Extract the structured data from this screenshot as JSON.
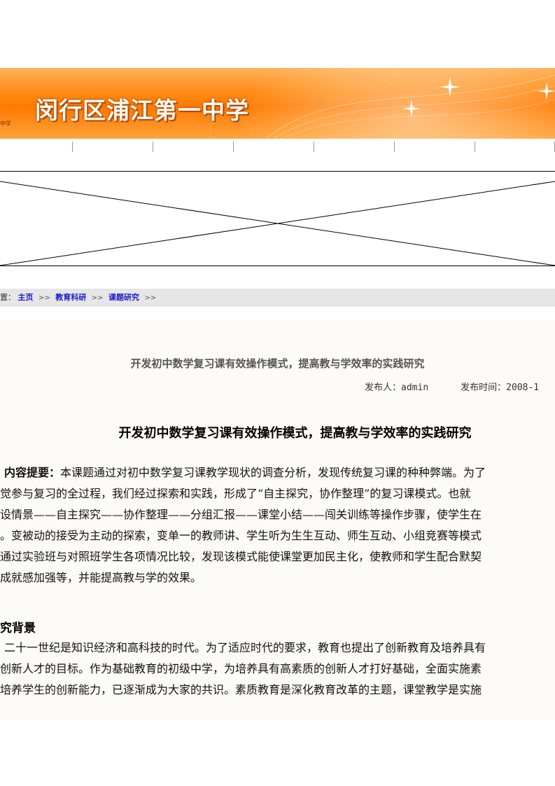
{
  "header": {
    "school_title": "闵行区浦江第一中学",
    "small_text": "中学"
  },
  "nav": {
    "item_count": 8
  },
  "breadcrumb": {
    "prefix": "置：",
    "items": [
      "主页",
      "教育科研",
      "课题研究"
    ],
    "separator": ">>"
  },
  "article": {
    "title": "开发初中数学复习课有效操作模式，提高教与学效率的实践研究",
    "publisher_label": "发布人：",
    "publisher": "admin",
    "time_label": "发布时间：",
    "time": "2008-1",
    "heading": "开发初中数学复习课有效操作模式，提高教与学效率的实践研究",
    "summary_label": "内容提要：",
    "summary_lines": [
      "本课题通过对初中数学复习课教学现状的调查分析，发现传统复习课的种种弊端。为了",
      "觉参与复习的全过程，我们经过探索和实践，形成了“自主探究，协作整理”的复习课模式。也就",
      "设情景——自主探究——协作整理——分组汇报——课堂小结——闯关训练等操作步骤，使学生在",
      "。变被动的接受为主动的探索，变单一的教师讲、学生听为生生互动、师生互动、小组竞赛等模式",
      "通过实验班与对照班学生各项情况比较，发现该模式能使课堂更加民主化，使教师和学生配合默契",
      "成就感加强等，并能提高教与学的效果。"
    ],
    "section_title": "究背景",
    "background_lines": [
      "二十一世纪是知识经济和高科技的时代。为了适应时代的要求，教育也提出了创新教育及培养具有",
      "创新人才的目标。作为基础教育的初级中学，为培养具有高素质的创新人才打好基础，全面实施素",
      "培养学生的创新能力，已逐渐成为大家的共识。素质教育是深化教育改革的主题，课堂教学是实施"
    ]
  }
}
